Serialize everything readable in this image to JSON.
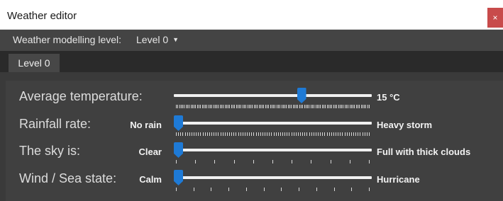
{
  "window": {
    "title": "Weather editor",
    "close_glyph": "×"
  },
  "modelling": {
    "label": "Weather modelling level:",
    "selected": "Level 0"
  },
  "tabs": [
    {
      "label": "Level 0"
    }
  ],
  "colors": {
    "accent": "#1e7ad6",
    "panel": "#404040",
    "close": "#c84b4b"
  },
  "sliders": [
    {
      "label": "Average temperature:",
      "min_label": "",
      "max_label": "15 °C",
      "value": 0.65,
      "ticks": 120
    },
    {
      "label": "Rainfall rate:",
      "min_label": "No rain",
      "max_label": "Heavy storm",
      "value": 0.0,
      "ticks": 88
    },
    {
      "label": "The sky is:",
      "min_label": "Clear",
      "max_label": "Full with thick clouds",
      "value": 0.0,
      "ticks": 11
    },
    {
      "label": "Wind / Sea state:",
      "min_label": "Calm",
      "max_label": "Hurricane",
      "value": 0.0,
      "ticks": 12
    }
  ]
}
